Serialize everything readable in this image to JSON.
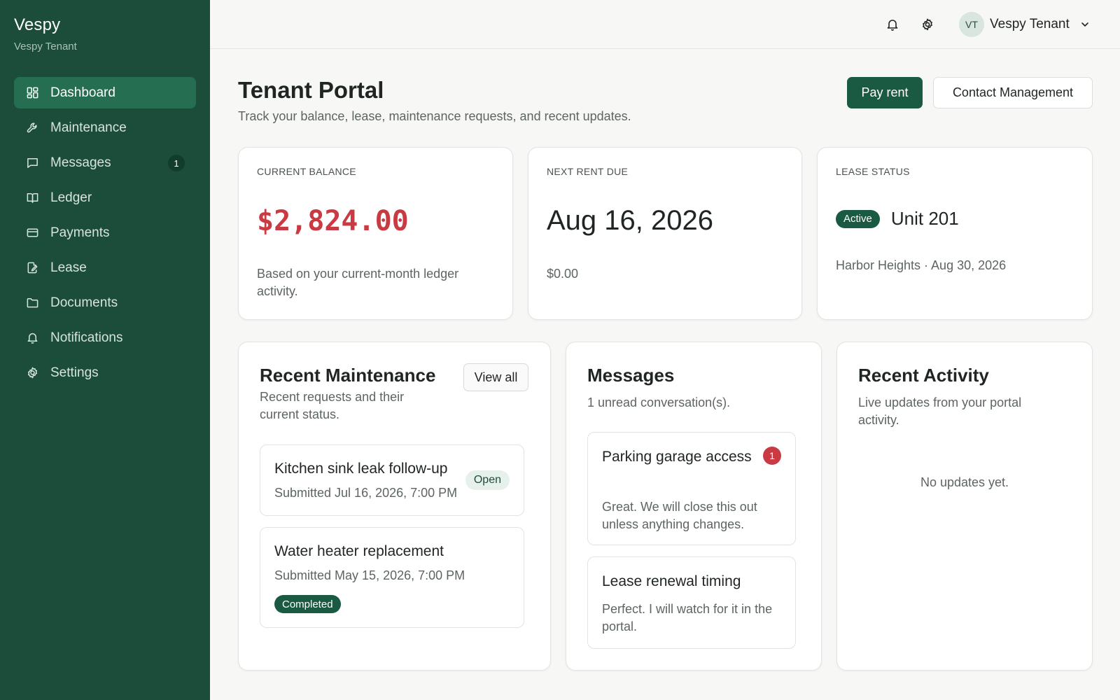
{
  "brand": {
    "name": "Vespy",
    "subtitle": "Vespy Tenant"
  },
  "sidebar": {
    "items": [
      {
        "label": "Dashboard",
        "icon": "dashboard-icon",
        "active": true
      },
      {
        "label": "Maintenance",
        "icon": "wrench-icon"
      },
      {
        "label": "Messages",
        "icon": "message-icon",
        "badge": "1"
      },
      {
        "label": "Ledger",
        "icon": "book-icon"
      },
      {
        "label": "Payments",
        "icon": "credit-card-icon"
      },
      {
        "label": "Lease",
        "icon": "document-edit-icon"
      },
      {
        "label": "Documents",
        "icon": "folder-icon"
      },
      {
        "label": "Notifications",
        "icon": "bell-icon"
      },
      {
        "label": "Settings",
        "icon": "gear-icon"
      }
    ]
  },
  "topbar": {
    "user": {
      "initials": "VT",
      "name": "Vespy Tenant"
    }
  },
  "header": {
    "title": "Tenant Portal",
    "subtitle": "Track your balance, lease, maintenance requests, and recent updates.",
    "pay_rent": "Pay rent",
    "contact": "Contact Management"
  },
  "stats": {
    "balance": {
      "label": "CURRENT BALANCE",
      "value": "$2,824.00",
      "note": "Based on your current-month ledger activity."
    },
    "rent": {
      "label": "NEXT RENT DUE",
      "value": "Aug 16, 2026",
      "note": "$0.00"
    },
    "lease": {
      "label": "LEASE STATUS",
      "status": "Active",
      "unit": "Unit 201",
      "note": "Harbor Heights · Aug 30, 2026"
    }
  },
  "maintenance": {
    "title": "Recent Maintenance",
    "subtitle": "Recent requests and their current status.",
    "view_all": "View all",
    "items": [
      {
        "title": "Kitchen sink leak follow-up",
        "date": "Submitted Jul 16, 2026, 7:00 PM",
        "status": "Open"
      },
      {
        "title": "Water heater replacement",
        "date": "Submitted May 15, 2026, 7:00 PM",
        "status": "Completed"
      }
    ]
  },
  "messages": {
    "title": "Messages",
    "subtitle": "1 unread conversation(s).",
    "items": [
      {
        "title": "Parking garage access",
        "body": "Great. We will close this out unless anything changes.",
        "unread": "1"
      },
      {
        "title": "Lease renewal timing",
        "body": "Perfect. I will watch for it in the portal."
      }
    ]
  },
  "activity": {
    "title": "Recent Activity",
    "subtitle": "Live updates from your portal activity.",
    "empty": "No updates yet."
  },
  "colors": {
    "sidebar_bg": "#1b4d3a",
    "accent": "#1b5a42",
    "danger": "#c93a43"
  }
}
